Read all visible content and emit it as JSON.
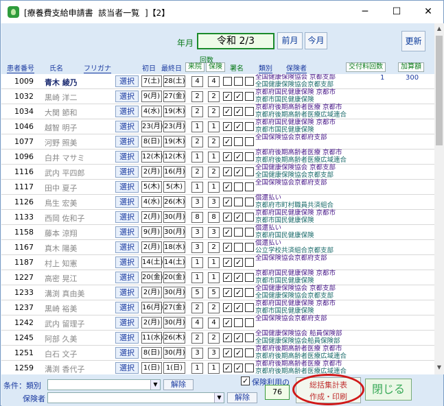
{
  "window": {
    "title": "[療養費支給申請書  該当者一覧  ]【2】",
    "minimize": "─",
    "maximize": "☐",
    "close": "✕"
  },
  "header": {
    "nengetsu_label": "年月",
    "nengetsu_value": "令和 2/3",
    "prev_month": "前月",
    "next_month": "今月",
    "update": "更新",
    "kaisu_group": "回数",
    "columns": {
      "patient_no": "患者番号",
      "name": "氏名",
      "furigana": "フリガナ",
      "first_day": "初日",
      "last_day": "最終日",
      "visits": "来院",
      "insurance": "保険",
      "signature": "署名",
      "category": "類別",
      "insurer": "保険者",
      "kofu_count": "交付料回数",
      "kasan": "加算額"
    }
  },
  "select_label": "選択",
  "rows": [
    {
      "no": "1009",
      "name": "青木  綾乃",
      "d1": "7(土)",
      "d2": "28(土)",
      "r1": "4",
      "r2": "4",
      "cb": [
        "",
        "",
        ""
      ],
      "ins1": "全国健康保険協会  京都支部",
      "ins2": "全国健康保険協会京都支部",
      "kofu": "1",
      "kasan": "300"
    },
    {
      "no": "1032",
      "name": "黒崎  洋二",
      "d1": "9(月)",
      "d2": "27(金)",
      "r1": "2",
      "r2": "2",
      "cb": [
        "✓",
        "✓",
        ""
      ],
      "ins1": "京都府国民健康保険  京都市",
      "ins2": "京都市国民健康保険",
      "kofu": "",
      "kasan": ""
    },
    {
      "no": "1034",
      "name": "大関  節和",
      "d1": "4(水)",
      "d2": "19(木)",
      "r1": "2",
      "r2": "2",
      "cb": [
        "✓",
        "✓",
        ""
      ],
      "ins1": "京都府後期高齢者医療  京都市",
      "ins2": "京都府後期高齢者医療広域連合",
      "kofu": "",
      "kasan": ""
    },
    {
      "no": "1046",
      "name": "越智  明子",
      "d1": "23(月)",
      "d2": "23(月)",
      "r1": "1",
      "r2": "1",
      "cb": [
        "✓",
        "✓",
        ""
      ],
      "ins1": "京都府国民健康保険  京都市",
      "ins2": "京都市国民健康保険",
      "kofu": "",
      "kasan": ""
    },
    {
      "no": "1077",
      "name": "河野  照美",
      "d1": "8(日)",
      "d2": "19(木)",
      "r1": "2",
      "r2": "2",
      "cb": [
        "✓",
        "",
        ""
      ],
      "ins1": "全国保険協会京都府支部",
      "ins2": "",
      "kofu": "",
      "kasan": ""
    },
    {
      "no": "1096",
      "name": "白井  マサミ",
      "d1": "12(木)",
      "d2": "12(木)",
      "r1": "1",
      "r2": "1",
      "cb": [
        "✓",
        "✓",
        ""
      ],
      "ins1": "京都府後期高齢者医療  京都市",
      "ins2": "京都府後期高齢者医療広域連合",
      "kofu": "",
      "kasan": ""
    },
    {
      "no": "1116",
      "name": "武内  平四郎",
      "d1": "2(月)",
      "d2": "16(月)",
      "r1": "2",
      "r2": "2",
      "cb": [
        "✓",
        "✓",
        ""
      ],
      "ins1": "全国健康保険協会  京都支部",
      "ins2": "全国健康保険協会京都支部",
      "kofu": "",
      "kasan": ""
    },
    {
      "no": "1117",
      "name": "田中  夏子",
      "d1": "5(木)",
      "d2": "5(木)",
      "r1": "1",
      "r2": "1",
      "cb": [
        "✓",
        "",
        ""
      ],
      "ins1": "全国保険協会京都府支部",
      "ins2": "",
      "kofu": "",
      "kasan": ""
    },
    {
      "no": "1126",
      "name": "鳥生  宏美",
      "d1": "4(水)",
      "d2": "26(木)",
      "r1": "3",
      "r2": "3",
      "cb": [
        "✓",
        "",
        ""
      ],
      "ins1": "償還払い",
      "ins2": "京都府市町村職員共済組合",
      "kofu": "",
      "kasan": ""
    },
    {
      "no": "1133",
      "name": "西岡  佐和子",
      "d1": "2(月)",
      "d2": "30(月)",
      "r1": "8",
      "r2": "8",
      "cb": [
        "✓",
        "✓",
        ""
      ],
      "ins1": "京都府国民健康保険  京都市",
      "ins2": "京都市国民健康保険",
      "kofu": "",
      "kasan": ""
    },
    {
      "no": "1158",
      "name": "藤本  涼翔",
      "d1": "9(月)",
      "d2": "30(月)",
      "r1": "3",
      "r2": "3",
      "cb": [
        "✓",
        "",
        ""
      ],
      "ins1": "償還払い",
      "ins2": "京都府国民健康保険",
      "kofu": "",
      "kasan": ""
    },
    {
      "no": "1167",
      "name": "真木  陽美",
      "d1": "2(月)",
      "d2": "18(水)",
      "r1": "3",
      "r2": "2",
      "cb": [
        "✓",
        "",
        ""
      ],
      "ins1": "償還払い",
      "ins2": "公立学校共済組合京都支部",
      "kofu": "",
      "kasan": ""
    },
    {
      "no": "1187",
      "name": "村上  知憲",
      "d1": "14(土)",
      "d2": "14(土)",
      "r1": "1",
      "r2": "1",
      "cb": [
        "✓",
        "✓",
        ""
      ],
      "ins1": "全国保険協会京都府支部",
      "ins2": "",
      "kofu": "",
      "kasan": ""
    },
    {
      "no": "1227",
      "name": "高密  晃江",
      "d1": "20(金)",
      "d2": "20(金)",
      "r1": "1",
      "r2": "1",
      "cb": [
        "✓",
        "✓",
        ""
      ],
      "ins1": "京都府国民健康保険  京都市",
      "ins2": "京都市国民健康保険",
      "kofu": "",
      "kasan": ""
    },
    {
      "no": "1233",
      "name": "溝渕  真由美",
      "d1": "2(月)",
      "d2": "30(月)",
      "r1": "5",
      "r2": "5",
      "cb": [
        "✓",
        "✓",
        ""
      ],
      "ins1": "全国健康保険協会  京都支部",
      "ins2": "全国健康保険協会京都支部",
      "kofu": "",
      "kasan": ""
    },
    {
      "no": "1237",
      "name": "黒崎  裕美",
      "d1": "16(月)",
      "d2": "27(金)",
      "r1": "2",
      "r2": "2",
      "cb": [
        "✓",
        "✓",
        ""
      ],
      "ins1": "京都府国民健康保険  京都市",
      "ins2": "京都市国民健康保険",
      "kofu": "",
      "kasan": ""
    },
    {
      "no": "1242",
      "name": "武内  留理子",
      "d1": "2(月)",
      "d2": "30(月)",
      "r1": "4",
      "r2": "4",
      "cb": [
        "✓",
        "",
        ""
      ],
      "ins1": "全国保険協会京都府支部",
      "ins2": "",
      "kofu": "",
      "kasan": ""
    },
    {
      "no": "1245",
      "name": "阿部  久美",
      "d1": "11(水)",
      "d2": "26(木)",
      "r1": "2",
      "r2": "2",
      "cb": [
        "✓",
        "✓",
        ""
      ],
      "ins1": "全国健康保険協会  船員保険部",
      "ins2": "全国健康保険協会船員保険部",
      "kofu": "",
      "kasan": ""
    },
    {
      "no": "1251",
      "name": "白石  文子",
      "d1": "8(日)",
      "d2": "30(月)",
      "r1": "3",
      "r2": "3",
      "cb": [
        "✓",
        "✓",
        ""
      ],
      "ins1": "京都府後期高齢者医療  京都市",
      "ins2": "京都府後期高齢者医療広域連合",
      "kofu": "",
      "kasan": ""
    },
    {
      "no": "1259",
      "name": "溝渕  香代子",
      "d1": "1(日)",
      "d2": "1(日)",
      "r1": "1",
      "r2": "1",
      "cb": [
        "✓",
        "✓",
        ""
      ],
      "ins1": "京都府後期高齢者医療  京都市",
      "ins2": "京都府後期高齢者医療広域連合",
      "kofu": "",
      "kasan": ""
    }
  ],
  "footer": {
    "cond_label": "条件：類別",
    "insurer_label": "保険者",
    "combo_arrow": "▼",
    "clear1": "解除",
    "clear2": "解除",
    "hoken_checkbox": "✓",
    "hoken_label": "保険利用の",
    "count": "76",
    "sokatsu_line1": "総括集計表",
    "sokatsu_line2": "作成・印刷",
    "close": "閉じる"
  },
  "scrollbar": {
    "up": "▲",
    "down": "▼"
  }
}
